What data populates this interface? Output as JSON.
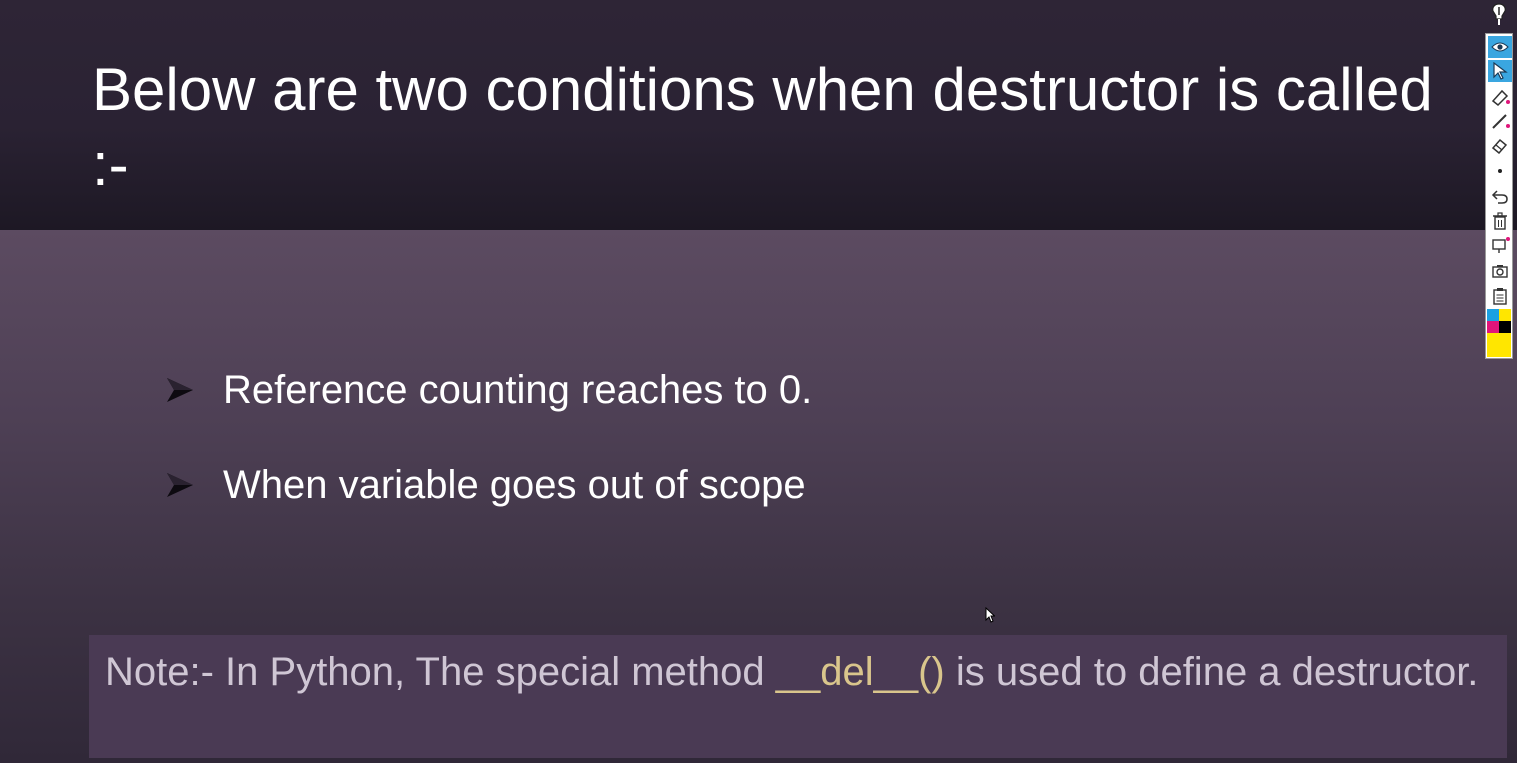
{
  "slide": {
    "title": "Below are two conditions when destructor is called :-",
    "bullets": [
      {
        "text": "Reference counting reaches to 0."
      },
      {
        "text": "When variable goes out of scope"
      }
    ],
    "note": {
      "prefix": "Note:- In Python, The special method ",
      "code": "__del__()",
      "suffix": " is used to define a destructor."
    }
  },
  "annotation_toolbar": {
    "tools": [
      {
        "name": "eye-icon",
        "active": true
      },
      {
        "name": "pointer-icon",
        "active": true
      },
      {
        "name": "highlighter-icon",
        "active": false
      },
      {
        "name": "pen-icon",
        "active": false
      },
      {
        "name": "eraser-icon",
        "active": false
      },
      {
        "name": "dot-icon",
        "active": false
      },
      {
        "name": "undo-icon",
        "active": false
      },
      {
        "name": "trash-icon",
        "active": false
      },
      {
        "name": "whiteboard-icon",
        "active": false
      },
      {
        "name": "camera-icon",
        "active": false
      },
      {
        "name": "clipboard-icon",
        "active": false
      }
    ],
    "colors": {
      "cyan": "#1ba1e2",
      "yellow": "#ffe600",
      "magenta": "#e0157a",
      "black": "#000000"
    }
  },
  "colors": {
    "title_text": "#ffffff",
    "note_text": "#cfc6d4",
    "note_code": "#d9c58c",
    "note_background": "#4a3a54",
    "active_tool": "#3aa6e0"
  }
}
